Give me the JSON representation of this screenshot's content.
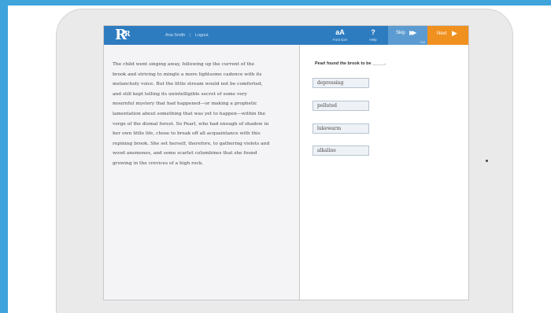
{
  "colors": {
    "page_bg": "#3fa4dc",
    "topbar": "#2e7cc0",
    "skip": "#5b9bd1",
    "next": "#f0901f",
    "reading_pane": "#f4f4f7"
  },
  "header": {
    "logo_text": "R",
    "logo_sup": "R",
    "user_link": "Aria Smith",
    "separator": "|",
    "logout_link": "Logout",
    "font_size_glyph": "aA",
    "font_size_label": "Font size",
    "help_glyph": "?",
    "help_label": "Help",
    "skip_label": "Skip",
    "skip_arrows": "▶▶",
    "skip_sub": "Full",
    "next_label": "Next",
    "next_arrow": "▶"
  },
  "passage": {
    "lines": [
      "The child went singing away, following up the current of the",
      "brook and striving to mingle a more lightsome cadence with its",
      "melancholy voice. But the little stream would not be comforted,",
      "and still kept telling its unintelligible secret of some very",
      "mournful mystery that had happened—or making a prophetic",
      "lamentation about something that was yet to happen—within the",
      "verge of the dismal forest. So Pearl, who had enough of shadow in",
      "her own little life, chose to break off all acquaintance with this",
      "repining brook. She set herself, therefore, to gathering violets and",
      "wood anemones, and some scarlet columbines that she found",
      "growing in the crevices of a high rock."
    ]
  },
  "question": {
    "prompt": "Pearl found the brook to be _____.",
    "options": [
      "depressing",
      "polluted",
      "lukewarm",
      "alkaline"
    ]
  }
}
